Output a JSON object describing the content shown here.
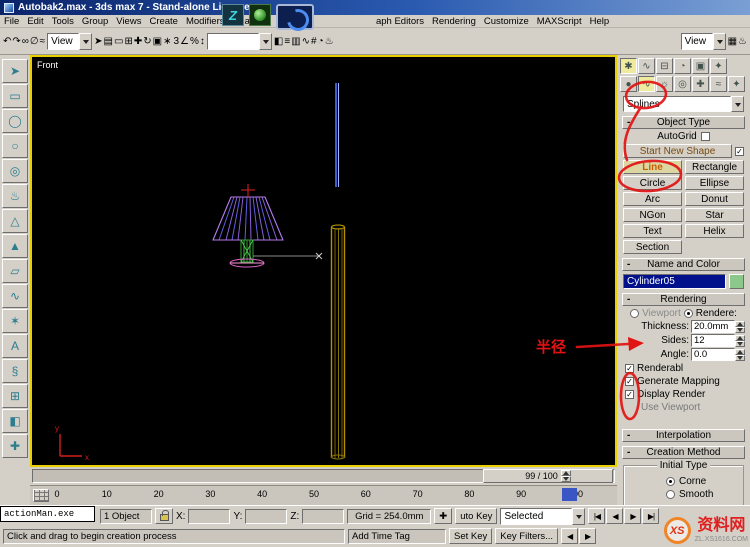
{
  "titlebar": {
    "title": "Autobak2.max - 3ds max 7 - Stand-alone License"
  },
  "menubar": {
    "left": [
      "File",
      "Edit",
      "Tools",
      "Group",
      "Views",
      "Create",
      "Modifiers",
      "Cha"
    ],
    "right": [
      "aph Editors",
      "Rendering",
      "Customize",
      "MAXScript",
      "Help"
    ]
  },
  "plugin_icons": {
    "z_tile": "Z"
  },
  "toolbar": {
    "group1": [
      {
        "name": "undo-icon",
        "glyph": "↶"
      },
      {
        "name": "redo-icon",
        "glyph": "↷"
      },
      {
        "name": "select-link-icon",
        "glyph": "∞"
      },
      {
        "name": "unlink-icon",
        "glyph": "∅"
      },
      {
        "name": "bind-spacewarp-icon",
        "glyph": "≈"
      }
    ],
    "ref_coord_dropdown": "View",
    "group2": [
      {
        "name": "select-icon",
        "glyph": "➤"
      },
      {
        "name": "select-by-name-icon",
        "glyph": "▤"
      },
      {
        "name": "region-icon",
        "glyph": "▭"
      },
      {
        "name": "window-crossing-icon",
        "glyph": "⊞"
      },
      {
        "name": "move-icon",
        "glyph": "✚"
      },
      {
        "name": "rotate-icon",
        "glyph": "↻"
      },
      {
        "name": "scale-icon",
        "glyph": "▣"
      },
      {
        "name": "manipulate-icon",
        "glyph": "∗"
      }
    ],
    "group3": [
      {
        "name": "snap-toggle-icon",
        "glyph": "3"
      },
      {
        "name": "angle-snap-icon",
        "glyph": "∠"
      },
      {
        "name": "percent-snap-icon",
        "glyph": "%"
      },
      {
        "name": "spinner-snap-icon",
        "glyph": "↕"
      }
    ],
    "named_sets_value": "",
    "group4": [
      {
        "name": "mirror-icon",
        "glyph": "◧"
      },
      {
        "name": "align-icon",
        "glyph": "≡"
      },
      {
        "name": "layer-manager-icon",
        "glyph": "▥"
      },
      {
        "name": "curve-editor-icon",
        "glyph": "∿"
      },
      {
        "name": "schematic-view-icon",
        "glyph": "#"
      },
      {
        "name": "material-editor-icon",
        "glyph": "◔"
      },
      {
        "name": "render-scene-icon",
        "glyph": "♨"
      }
    ],
    "view_dropdown": "View",
    "group5": [
      {
        "name": "render-type-icon",
        "glyph": "▦"
      },
      {
        "name": "quick-render-icon",
        "glyph": "♨"
      }
    ]
  },
  "left_toolbar": {
    "icons": [
      {
        "name": "pointer-tool-icon",
        "glyph": "➤"
      },
      {
        "name": "box-tool-icon",
        "glyph": "▭"
      },
      {
        "name": "sphere-tool-icon",
        "glyph": "◯"
      },
      {
        "name": "circle-tool-icon",
        "glyph": "○"
      },
      {
        "name": "torus-tool-icon",
        "glyph": "◎"
      },
      {
        "name": "teapot-tool-icon",
        "glyph": "♨"
      },
      {
        "name": "cone-tool-icon",
        "glyph": "△"
      },
      {
        "name": "pyramid-tool-icon",
        "glyph": "▲"
      },
      {
        "name": "plane-tool-icon",
        "glyph": "▱"
      },
      {
        "name": "spline-tool-icon",
        "glyph": "∿"
      },
      {
        "name": "star-tool-icon",
        "glyph": "✶"
      },
      {
        "name": "text-tool-icon",
        "glyph": "A"
      },
      {
        "name": "helix-tool-icon",
        "glyph": "§"
      },
      {
        "name": "grid-tool-icon",
        "glyph": "⊞"
      },
      {
        "name": "mirror-tool-icon",
        "glyph": "◧"
      },
      {
        "name": "cross-tool-icon",
        "glyph": "✚"
      }
    ]
  },
  "viewport": {
    "label": "Front"
  },
  "panel": {
    "tabs": [
      {
        "name": "tab-create",
        "glyph": "✱",
        "active": true
      },
      {
        "name": "tab-modify",
        "glyph": "∿"
      },
      {
        "name": "tab-hierarchy",
        "glyph": "⊟"
      },
      {
        "name": "tab-motion",
        "glyph": "◔"
      },
      {
        "name": "tab-display",
        "glyph": "▣"
      },
      {
        "name": "tab-utilities",
        "glyph": "✦"
      }
    ],
    "subtabs": [
      {
        "name": "subtab-geometry",
        "glyph": "●"
      },
      {
        "name": "subtab-shapes",
        "glyph": "∿",
        "active": true
      },
      {
        "name": "subtab-lights",
        "glyph": "☼"
      },
      {
        "name": "subtab-cameras",
        "glyph": "◎"
      },
      {
        "name": "subtab-helpers",
        "glyph": "✚"
      },
      {
        "name": "subtab-spacewarps",
        "glyph": "≈"
      },
      {
        "name": "subtab-systems",
        "glyph": "✦"
      }
    ],
    "category_dropdown": "Splines",
    "collapse_glyph": "-",
    "object_type": {
      "header": "Object Type",
      "autogrid": "AutoGrid",
      "start_new_shape": "Start New Shape",
      "buttons": [
        "Line",
        "Rectangle",
        "Circle",
        "Ellipse",
        "Arc",
        "Donut",
        "NGon",
        "Star",
        "Text",
        "Helix",
        "Section"
      ],
      "active": "Line"
    },
    "name_color": {
      "header": "Name and Color",
      "name": "Cylinder05"
    },
    "rendering": {
      "header": "Rendering",
      "viewport_radio": "Viewport",
      "renderer_radio": "Rendere:",
      "rows": [
        {
          "label": "Thickness:",
          "value": "20.0mm"
        },
        {
          "label": "Sides:",
          "value": "12"
        },
        {
          "label": "Angle:",
          "value": "0.0"
        }
      ],
      "checkboxes": [
        "Renderabl",
        "Generate Mapping",
        "Display Render"
      ],
      "use_viewport": "Use Viewport"
    },
    "interpolation": {
      "header": "Interpolation"
    },
    "creation_method": {
      "header": "Creation Method",
      "group_title": "Initial Type",
      "radios": [
        "Corne",
        "Smooth"
      ],
      "selected": "Corne"
    }
  },
  "timeline": {
    "slider": "99 / 100",
    "ticks": [
      "0",
      "10",
      "20",
      "30",
      "40",
      "50",
      "60",
      "70",
      "80",
      "90",
      "100"
    ]
  },
  "statusbar": {
    "overlay": "actionMan.exe",
    "objects": "1 Object",
    "x_label": "X:",
    "x_value": "",
    "y_label": "Y:",
    "y_value": "",
    "z_label": "Z:",
    "z_value": "",
    "grid": "Grid = 254.0mm",
    "pan_glyph": "✚",
    "auto_key": "uto Key",
    "selected": "Selected",
    "set_key": "Set Key",
    "key_filters": "Key Filters...",
    "prompt": "Click and drag to begin creation process",
    "add_time_tag": "Add Time Tag",
    "playback": [
      {
        "name": "goto-start-icon",
        "glyph": "|◀"
      },
      {
        "name": "prev-frame-icon",
        "glyph": "◀"
      },
      {
        "name": "play-icon",
        "glyph": "▶"
      },
      {
        "name": "goto-end-icon",
        "glyph": "▶|"
      }
    ],
    "nav": [
      {
        "name": "prev-key-icon",
        "glyph": "◀"
      },
      {
        "name": "next-key-icon",
        "glyph": "▶"
      }
    ]
  },
  "icons": {
    "check": "✓"
  },
  "annotations": {
    "radius_label": "半径"
  },
  "watermark": {
    "logo": "XS",
    "name": "资料网",
    "url": "ZL.XS1616.COM"
  }
}
